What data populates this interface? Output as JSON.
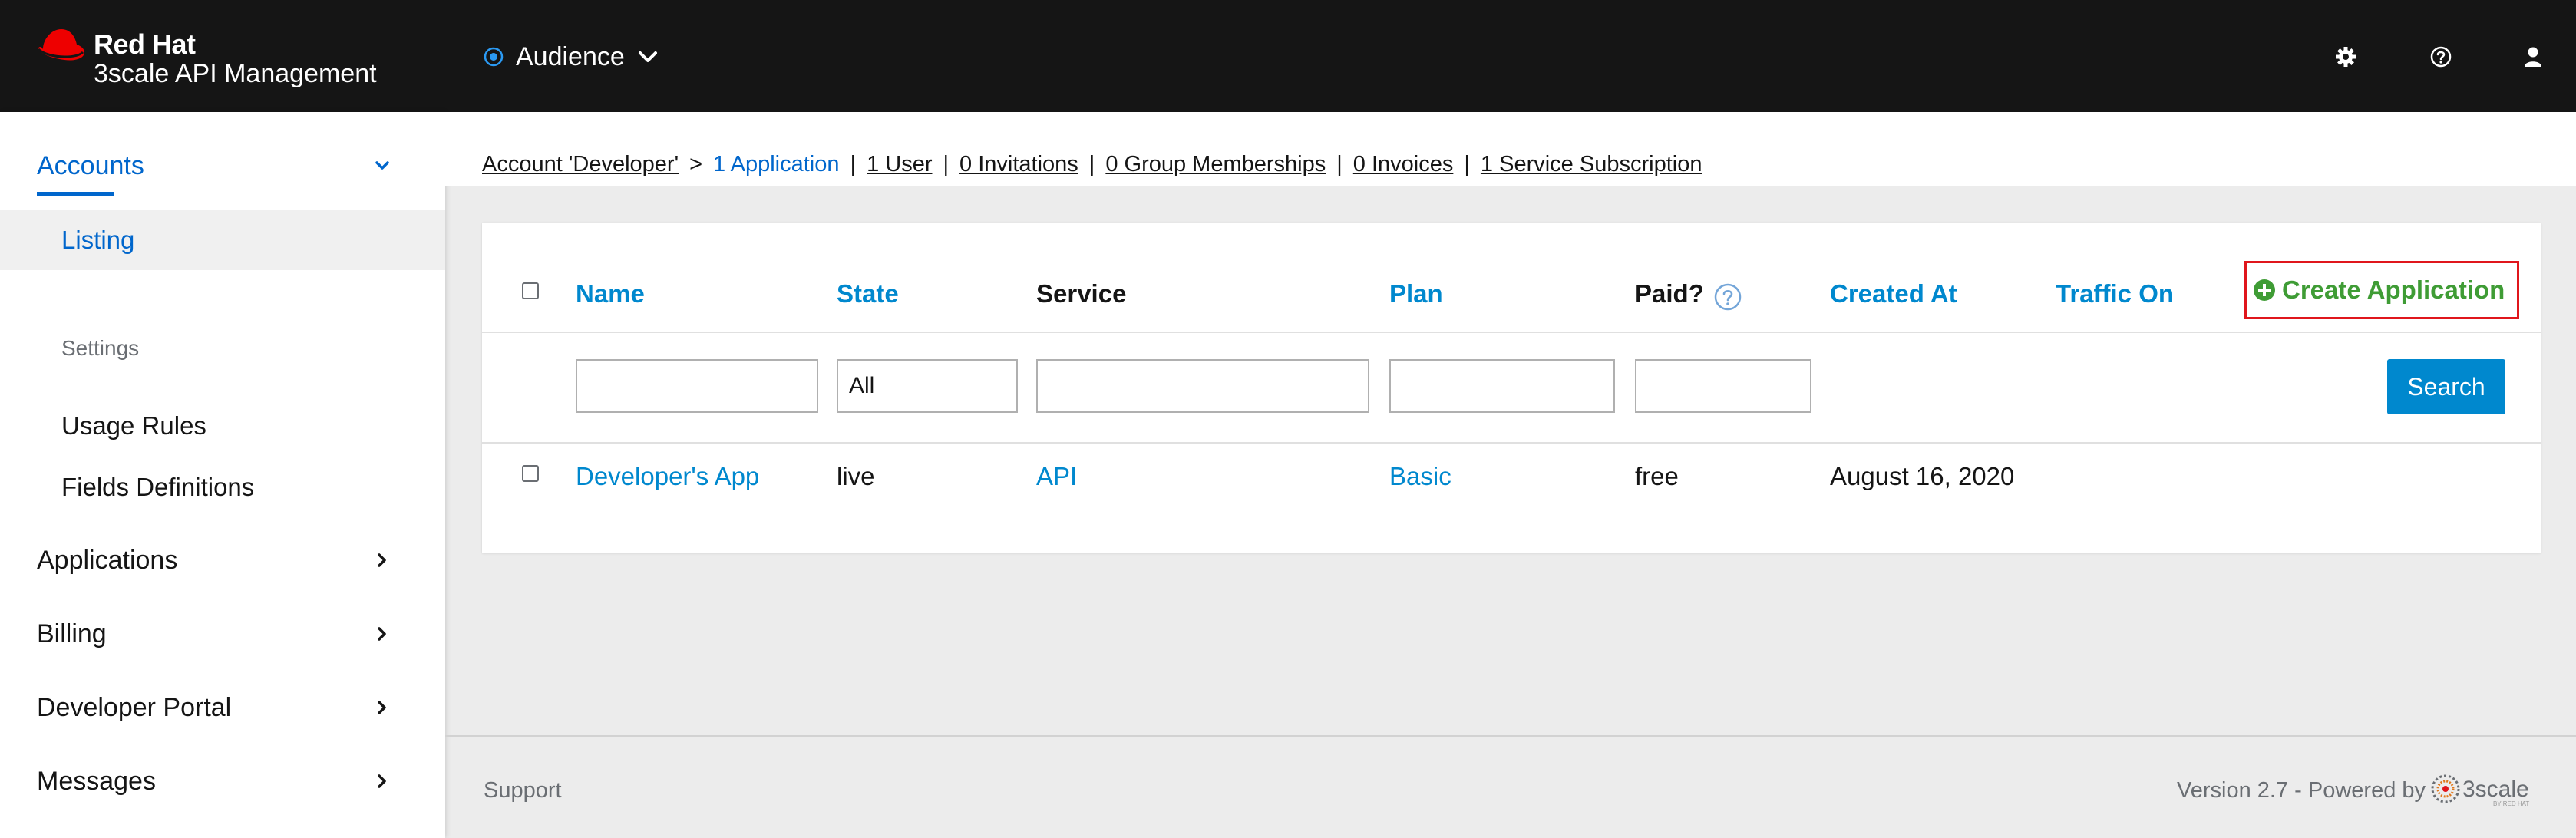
{
  "masthead": {
    "brand_name": "Red Hat",
    "brand_product": "3scale API Management",
    "context_label": "Audience",
    "icons": [
      "gear-icon",
      "help-icon",
      "user-icon"
    ]
  },
  "sidebar": {
    "sections": [
      {
        "label": "Accounts",
        "expanded": true
      },
      {
        "label": "Applications",
        "expanded": false
      },
      {
        "label": "Billing",
        "expanded": false
      },
      {
        "label": "Developer Portal",
        "expanded": false
      },
      {
        "label": "Messages",
        "expanded": false
      }
    ],
    "accounts_items": {
      "listing": "Listing",
      "settings_group": "Settings",
      "usage_rules": "Usage Rules",
      "fields_definitions": "Fields Definitions"
    }
  },
  "breadcrumb": {
    "account": "Account 'Developer'",
    "gt": ">",
    "current": "1 Application",
    "sep": "|",
    "links": [
      "1 User",
      "0 Invitations",
      "0 Group Memberships",
      "0 Invoices",
      "1 Service Subscription"
    ]
  },
  "table": {
    "headers": {
      "name": "Name",
      "state": "State",
      "service": "Service",
      "plan": "Plan",
      "paid": "Paid?",
      "created_at": "Created At",
      "traffic_on": "Traffic On"
    },
    "create_label": "Create Application",
    "filters": {
      "state_value": "All"
    },
    "search_label": "Search",
    "rows": [
      {
        "name": "Developer's App",
        "state": "live",
        "service": "API",
        "plan": "Basic",
        "paid": "free",
        "created_at": "August 16, 2020",
        "traffic_on": ""
      }
    ]
  },
  "footer": {
    "support": "Support",
    "version": "Version 2.7 - Powered by",
    "logo_text": "3scale",
    "logo_sub": "BY RED HAT"
  },
  "colors": {
    "masthead_bg": "#151515",
    "link_blue": "#0088ce",
    "nav_active": "#0066cc",
    "create_green": "#3f9c35",
    "highlight_red": "#e0161c",
    "search_button": "#0088ce"
  }
}
